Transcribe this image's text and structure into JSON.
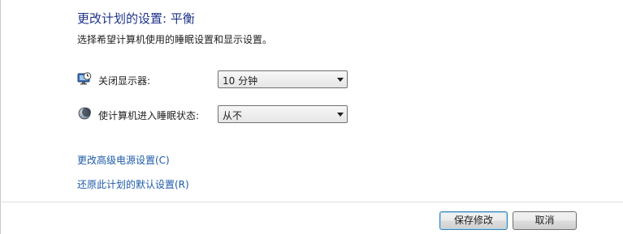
{
  "page": {
    "title": "更改计划的设置: 平衡",
    "subtitle": "选择希望计算机使用的睡眠设置和显示设置。"
  },
  "settings": {
    "display_off": {
      "label": "关闭显示器:",
      "value": "10 分钟",
      "icon": "monitor-clock-icon"
    },
    "sleep": {
      "label": "使计算机进入睡眠状态:",
      "value": "从不",
      "icon": "moon-sleep-icon"
    }
  },
  "links": {
    "advanced": "更改高级电源设置(C)",
    "restore": "还原此计划的默认设置(R)"
  },
  "buttons": {
    "save": "保存修改",
    "cancel": "取消"
  },
  "colors": {
    "title": "#1e3287",
    "link": "#1e5aa8"
  }
}
